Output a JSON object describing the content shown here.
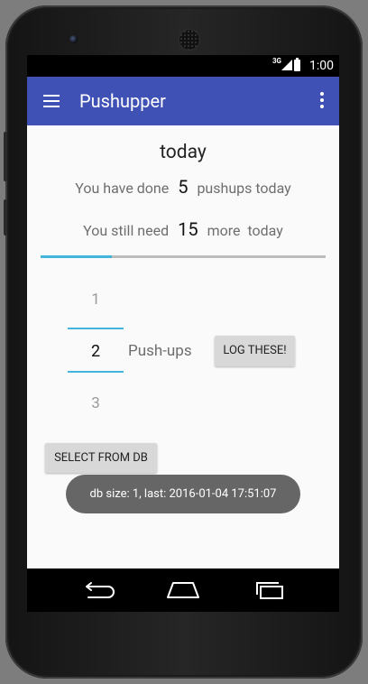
{
  "status_bar": {
    "network_type": "3G",
    "time": "1:00",
    "icons": [
      "signal-icon",
      "battery-icon"
    ]
  },
  "app_bar": {
    "title": "Pushupper",
    "icons": [
      "menu-icon",
      "overflow-menu-icon"
    ],
    "color": "#3f51b5"
  },
  "summary": {
    "day_label": "today",
    "done_prefix": "You have done",
    "done_count": "5",
    "done_suffix": "pushups today",
    "need_prefix": "You still need",
    "need_count": "15",
    "need_middle": "more",
    "need_suffix": "today"
  },
  "progress": {
    "value": 0.25,
    "fill_color": "#43b5dd",
    "track_color": "#bdbdbd"
  },
  "picker": {
    "previous": "1",
    "selected": "2",
    "next": "3",
    "unit_label": "Push-ups"
  },
  "buttons": {
    "log": "LOG THESE!",
    "select_db": "SELECT FROM DB"
  },
  "toast": {
    "text": "db size: 1, last: 2016-01-04 17:51:07"
  },
  "nav_bar": {
    "icons": [
      "back-icon",
      "home-icon",
      "recents-icon"
    ]
  }
}
